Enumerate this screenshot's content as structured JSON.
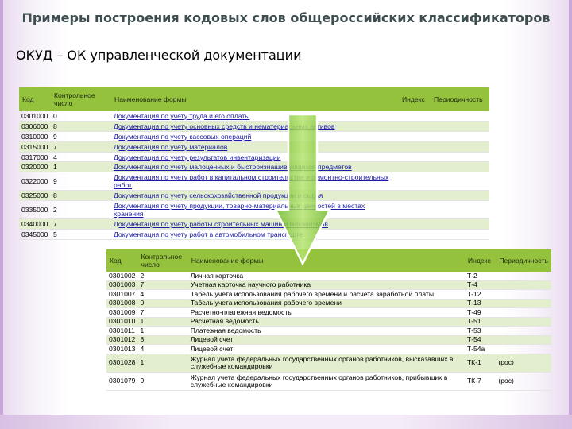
{
  "title": "Примеры построения кодовых слов общероссийских классификаторов",
  "subtitle": "ОКУД – ОК управленческой документации",
  "table1": {
    "headers": {
      "code": "Код",
      "check": "Контрольное число",
      "name": "Наименование формы",
      "index": "Индекс",
      "period": "Периодичность"
    },
    "rows": [
      {
        "code": "0301000",
        "check": "0",
        "name": "Документация по учету труда и его оплаты"
      },
      {
        "code": "0306000",
        "check": "8",
        "name": "Документация по учету основных средств и нематериальных активов"
      },
      {
        "code": "0310000",
        "check": "9",
        "name": "Документация по учету кассовых операций"
      },
      {
        "code": "0315000",
        "check": "7",
        "name": "Документация по учету материалов"
      },
      {
        "code": "0317000",
        "check": "4",
        "name": "Документация по учету результатов инвентаризации"
      },
      {
        "code": "0320000",
        "check": "1",
        "name": "Документация по учету малоценных и быстроизнашивающихся предметов"
      },
      {
        "code": "0322000",
        "check": "9",
        "name": "Документация по учету работ в капитальном строительстве и ремонтно-строительных работ"
      },
      {
        "code": "0325000",
        "check": "8",
        "name": "Документация по учету сельскохозяйственной продукции и сырья"
      },
      {
        "code": "0335000",
        "check": "2",
        "name": "Документация по учету продукции, товарно-материальных ценностей в местах хранения"
      },
      {
        "code": "0340000",
        "check": "7",
        "name": "Документация по учету работы строительных машин и механизмов"
      },
      {
        "code": "0345000",
        "check": "5",
        "name": "Документация по учету работ в автомобильном транспорте"
      }
    ]
  },
  "table2": {
    "headers": {
      "code": "Код",
      "check": "Контрольное число",
      "name": "Наименование формы",
      "index": "Индекс",
      "period": "Периодичность"
    },
    "rows": [
      {
        "code": "0301002",
        "check": "2",
        "name": "Личная карточка",
        "index": "Т-2",
        "period": ""
      },
      {
        "code": "0301003",
        "check": "7",
        "name": "Учетная карточка научного работника",
        "index": "Т-4",
        "period": ""
      },
      {
        "code": "0301007",
        "check": "4",
        "name": "Табель учета использования рабочего времени и расчета заработной платы",
        "index": "Т-12",
        "period": ""
      },
      {
        "code": "0301008",
        "check": "0",
        "name": "Табель учета использования рабочего времени",
        "index": "Т-13",
        "period": ""
      },
      {
        "code": "0301009",
        "check": "7",
        "name": "Расчетно-платежная ведомость",
        "index": "Т-49",
        "period": ""
      },
      {
        "code": "0301010",
        "check": "1",
        "name": "Расчетная ведомость",
        "index": "Т-51",
        "period": ""
      },
      {
        "code": "0301011",
        "check": "1",
        "name": "Платежная ведомость",
        "index": "Т-53",
        "period": ""
      },
      {
        "code": "0301012",
        "check": "8",
        "name": "Лицевой счет",
        "index": "Т-54",
        "period": ""
      },
      {
        "code": "0301013",
        "check": "4",
        "name": "Лицевой счет",
        "index": "Т-54а",
        "period": ""
      },
      {
        "code": "0301028",
        "check": "1",
        "name": "Журнал учета федеральных государственных органов работников, высказавших в служебные командировки",
        "index": "ТК-1",
        "period": "(рос)"
      },
      {
        "code": "0301079",
        "check": "9",
        "name": "Журнал учета федеральных государственных органов работников, прибывших в служебные командировки",
        "index": "ТК-7",
        "period": "(рос)"
      }
    ]
  },
  "colors": {
    "header_green": "#94c23d",
    "row_alt": "#e2eecd",
    "link_blue": "#1a1aa8",
    "arrow": "#8ccf3a"
  }
}
